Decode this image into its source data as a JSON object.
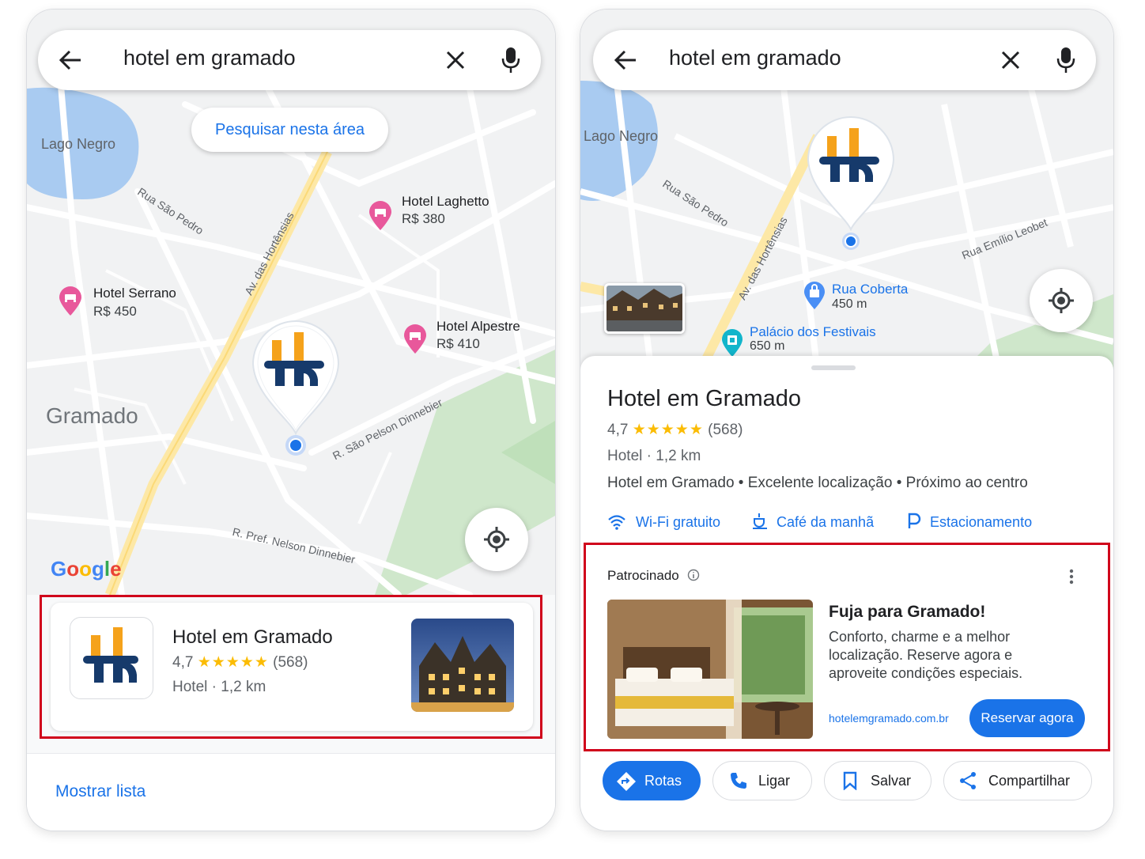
{
  "colors": {
    "accent": "#1a73e8",
    "highlight_box": "#d0021b",
    "star": "#fbbc04",
    "pin_pink": "#e8589b",
    "brand_orange": "#f5a21b",
    "brand_navy": "#163a6b"
  },
  "left": {
    "search": {
      "query": "hotel em gramado",
      "back_icon": "arrow-left-icon",
      "clear_icon": "close-icon",
      "voice_icon": "mic-icon"
    },
    "search_area_button": "Pesquisar nesta área",
    "map": {
      "lake": "Lago Negro",
      "city": "Gramado",
      "streets": [
        "Rua São Pedro",
        "Av. das Hortênsias",
        "R. São Pelson Dinnebier",
        "R. Pref. Nelson Dinnebier"
      ],
      "hotels": [
        {
          "name": "Hotel Laghetto",
          "price": "R$ 380"
        },
        {
          "name": "Hotel Serrano",
          "price": "R$ 450"
        },
        {
          "name": "Hotel Alpestre",
          "price": "R$ 410"
        }
      ],
      "google": "Google"
    },
    "card": {
      "name": "Hotel em Gramado",
      "rating": "4,7",
      "reviews": "(568)",
      "category": "Hotel",
      "distance": "1,2 km",
      "separator": "·"
    },
    "show_list": "Mostrar lista"
  },
  "right": {
    "search": {
      "query": "hotel em gramado"
    },
    "map": {
      "lake": "Lago Negro",
      "streets": [
        "Rua São Pedro",
        "Av. das Hortênsias",
        "Rua Emílio Leobet"
      ],
      "pois": [
        {
          "name": "Rua Coberta",
          "distance": "450 m",
          "icon": "shopping-bag-icon"
        },
        {
          "name": "Palácio dos Festivais",
          "distance": "650 m",
          "icon": "film-icon"
        }
      ]
    },
    "place": {
      "name": "Hotel em Gramado",
      "rating": "4,7",
      "reviews": "(568)",
      "category": "Hotel",
      "distance": "1,2 km",
      "separator": "·",
      "description": "Hotel em Gramado • Excelente localização • Próximo ao centro",
      "amenities": [
        {
          "label": "Wi-Fi gratuito",
          "icon": "wifi-icon"
        },
        {
          "label": "Café da manhã",
          "icon": "breakfast-icon"
        },
        {
          "label": "Estacionamento",
          "icon": "parking-icon"
        }
      ]
    },
    "ad": {
      "sponsored": "Patrocinado",
      "title": "Fuja para Gramado!",
      "line1": "Conforto, charme e a melhor",
      "line2": "localização. Reserve agora e",
      "line3": "aproveite condições especiais.",
      "url": "hotelemgramado.com.br",
      "cta": "Reservar agora"
    },
    "actions": {
      "directions": "Rotas",
      "call": "Ligar",
      "save": "Salvar",
      "share": "Compartilhar"
    }
  }
}
